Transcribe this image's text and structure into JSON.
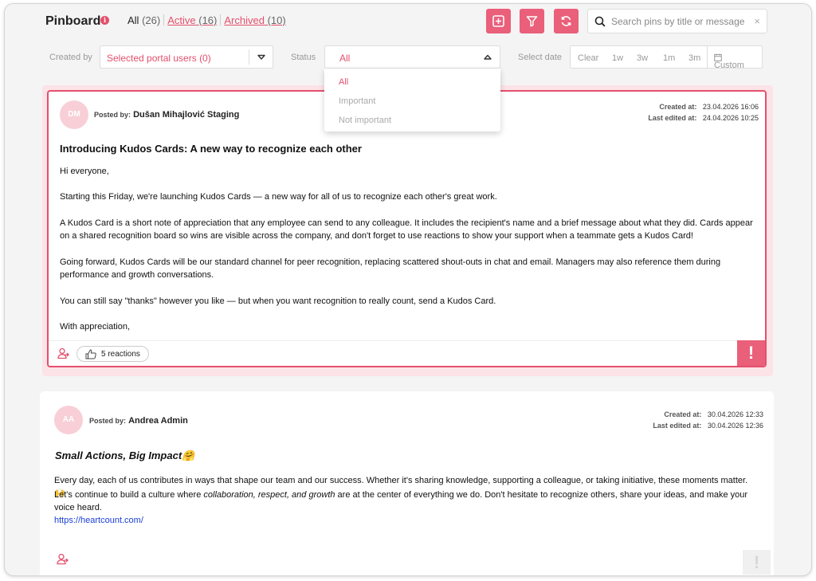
{
  "header": {
    "title": "Pinboard",
    "tabs": [
      {
        "label": "All",
        "count": "(26)"
      },
      {
        "label": "Active",
        "count": "(16)"
      },
      {
        "label": "Archived",
        "count": "(10)"
      }
    ],
    "search_placeholder": "Search pins by title or message",
    "search_clear": "×"
  },
  "filters": {
    "created_by_label": "Created by",
    "created_by_value": "Selected portal users (0)",
    "status_label": "Status",
    "status_value": "All",
    "date_label": "Select date",
    "date_options": [
      "Clear",
      "1w",
      "3w",
      "1m",
      "3m",
      "Custom"
    ]
  },
  "status_dropdown": {
    "options": [
      "All",
      "Important",
      "Not important"
    ],
    "selected": "All"
  },
  "pins": [
    {
      "avatar": "DM",
      "posted_by_label": "Posted by:",
      "author": "Dušan Mihajlović Staging",
      "created_label": "Created at:",
      "created_at": "23.04.2026 16:06",
      "edited_label": "Last edited at:",
      "edited_at": "24.04.2026 10:25",
      "title": "Introducing Kudos Cards: A new way to recognize each other",
      "paragraphs": [
        "Hi everyone,",
        "Starting this Friday, we're launching Kudos Cards — a new way for all of us to recognize each other's great work.",
        "A Kudos Card is a short note of appreciation that any employee can send to any colleague. It includes the recipient's name and a brief message about what they did. Cards appear on a shared recognition board so wins are visible across the company, and don't forget to use reactions to show your support when a teammate gets a Kudos Card!",
        "Going forward, Kudos Cards will be our standard channel for peer recognition, replacing scattered shout-outs in chat and email. Managers may also reference them during performance and growth conversations.",
        "You can still say \"thanks\" however you like — but when you want recognition to really count, send a Kudos Card.",
        "With appreciation,"
      ],
      "reactions": "5 reactions",
      "important_mark": "!"
    },
    {
      "avatar": "AA",
      "posted_by_label": "Posted by:",
      "author": "Andrea Admin",
      "created_label": "Created at:",
      "created_at": "30.04.2026 12:33",
      "edited_label": "Last edited at:",
      "edited_at": "30.04.2026 12:36",
      "title": "Small Actions, Big Impact",
      "title_emoji": "🤗",
      "p1": "Every day, each of us contributes in ways that shape our team and our success. Whether it's sharing knowledge, supporting a colleague, or taking initiative, these moments matter.",
      "p1_emoji": "🙌",
      "p2_a": "Let's continue to build a culture where ",
      "p2_em": "collaboration, respect, and growth",
      "p2_b": " are at the center of everything we do. Don't hesitate to recognize others, share your ideas, and make your voice heard.",
      "link": "https://heartcount.com/",
      "important_mark": "!"
    }
  ],
  "colors": {
    "accent": "#e4506c",
    "accent_button": "#ea5f7a",
    "link": "#1a3fd6"
  }
}
